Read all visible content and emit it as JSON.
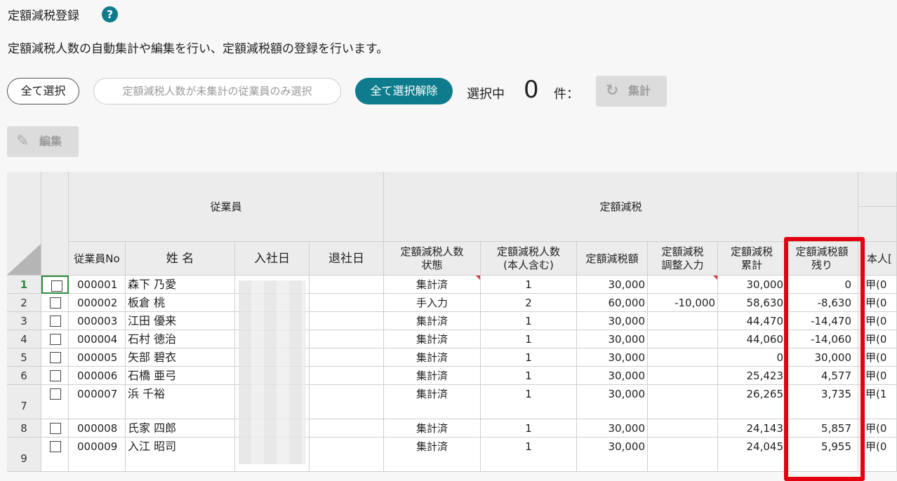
{
  "header": {
    "title": "定額減税登録",
    "help_icon": "?",
    "description": "定額減税人数の自動集計や編集を行い、定額減税額の登録を行います。"
  },
  "toolbar": {
    "select_all": "全て選択",
    "select_unaggregated": "定額減税人数が未集計の従業員のみ選択",
    "deselect_all": "全て選択解除",
    "selected_label": "選択中",
    "selected_count": "0",
    "selected_unit": "件：",
    "aggregate": "集計",
    "edit": "編集"
  },
  "table": {
    "group_headers": {
      "employee": "従業員",
      "tax": "定額減税"
    },
    "columns": {
      "emp_no": "従業員No",
      "name": "姓 名",
      "join_date": "入社日",
      "leave_date": "退社日",
      "count_status_1": "定額減税人数",
      "count_status_2": "状態",
      "count_incl_1": "定額減税人数",
      "count_incl_2": "(本人含む)",
      "amount": "定額減税額",
      "adjust_1": "定額減税",
      "adjust_2": "調整入力",
      "cumulative_1": "定額減税",
      "cumulative_2": "累計",
      "remaining_1": "定額減税額",
      "remaining_2": "残り",
      "self_partial": "本人[",
      "extra_partial": "甲"
    },
    "rows": [
      {
        "no": "1",
        "emp_no": "000001",
        "name": "森下 乃愛",
        "status": "集計済",
        "count": "1",
        "amount": "30,000",
        "adjust": "",
        "cumulative": "30,000",
        "remaining": "0",
        "self": "甲(0"
      },
      {
        "no": "2",
        "emp_no": "000002",
        "name": "板倉 桃",
        "status": "手入力",
        "count": "2",
        "amount": "60,000",
        "adjust": "-10,000",
        "cumulative": "58,630",
        "remaining": "-8,630",
        "self": "甲(0"
      },
      {
        "no": "3",
        "emp_no": "000003",
        "name": "江田 優来",
        "status": "集計済",
        "count": "1",
        "amount": "30,000",
        "adjust": "",
        "cumulative": "44,470",
        "remaining": "-14,470",
        "self": "甲(0"
      },
      {
        "no": "4",
        "emp_no": "000004",
        "name": "石村 徳治",
        "status": "集計済",
        "count": "1",
        "amount": "30,000",
        "adjust": "",
        "cumulative": "44,060",
        "remaining": "-14,060",
        "self": "甲(0"
      },
      {
        "no": "5",
        "emp_no": "000005",
        "name": "矢部 碧衣",
        "status": "集計済",
        "count": "1",
        "amount": "30,000",
        "adjust": "",
        "cumulative": "0",
        "remaining": "30,000",
        "self": "甲(0"
      },
      {
        "no": "6",
        "emp_no": "000006",
        "name": "石橋 亜弓",
        "status": "集計済",
        "count": "1",
        "amount": "30,000",
        "adjust": "",
        "cumulative": "25,423",
        "remaining": "4,577",
        "self": "甲(0"
      },
      {
        "no": "7",
        "emp_no": "000007",
        "name": "浜 千裕",
        "status": "集計済",
        "count": "1",
        "amount": "30,000",
        "adjust": "",
        "cumulative": "26,265",
        "remaining": "3,735",
        "self": "甲(1"
      },
      {
        "no": "8",
        "emp_no": "000008",
        "name": "氏家 四郎",
        "status": "集計済",
        "count": "1",
        "amount": "30,000",
        "adjust": "",
        "cumulative": "24,143",
        "remaining": "5,857",
        "self": "甲(0"
      },
      {
        "no": "9",
        "emp_no": "000009",
        "name": "入江 昭司",
        "status": "集計済",
        "count": "1",
        "amount": "30,000",
        "adjust": "",
        "cumulative": "24,045",
        "remaining": "5,955",
        "self": "甲(0"
      }
    ]
  }
}
